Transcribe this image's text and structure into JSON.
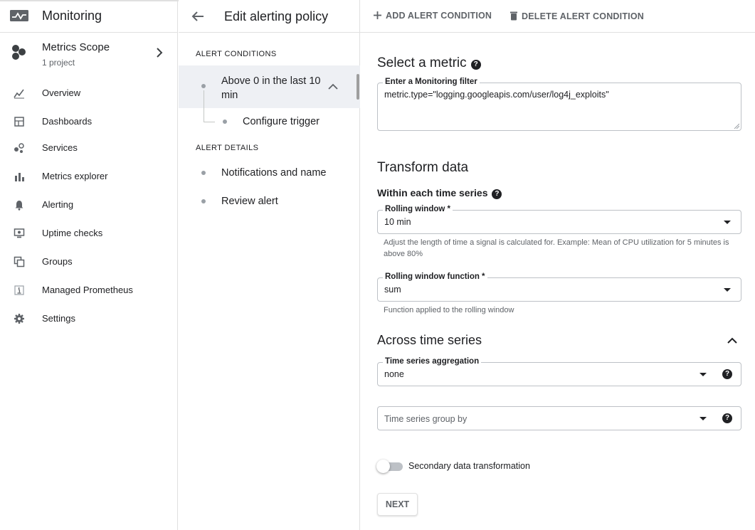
{
  "app": {
    "title": "Monitoring",
    "icon": "monitoring-logo-icon"
  },
  "scope": {
    "title": "Metrics Scope",
    "subtitle": "1 project"
  },
  "nav": [
    {
      "label": "Overview",
      "icon": "overview-icon"
    },
    {
      "label": "Dashboards",
      "icon": "dashboards-icon"
    },
    {
      "label": "Services",
      "icon": "services-icon"
    },
    {
      "label": "Metrics explorer",
      "icon": "bar-chart-icon"
    },
    {
      "label": "Alerting",
      "icon": "bell-icon"
    },
    {
      "label": "Uptime checks",
      "icon": "monitor-icon"
    },
    {
      "label": "Groups",
      "icon": "groups-icon"
    },
    {
      "label": "Managed Prometheus",
      "icon": "prometheus-icon"
    },
    {
      "label": "Settings",
      "icon": "gear-icon"
    }
  ],
  "header": {
    "title": "Edit alerting policy",
    "add_condition": "ADD ALERT CONDITION",
    "delete_condition": "DELETE ALERT CONDITION"
  },
  "steps": {
    "conditions_label": "ALERT CONDITIONS",
    "condition_1": "Above 0 in the last 10 min",
    "configure_trigger": "Configure trigger",
    "details_label": "ALERT DETAILS",
    "notifications": "Notifications and name",
    "review": "Review alert"
  },
  "metric": {
    "heading": "Select a metric",
    "filter_label": "Enter a Monitoring filter",
    "filter_value": "metric.type=\"logging.googleapis.com/user/log4j_exploits\""
  },
  "transform": {
    "heading": "Transform data",
    "within_heading": "Within each time series",
    "rolling_window_label": "Rolling window *",
    "rolling_window_value": "10 min",
    "rolling_window_hint": "Adjust the length of time a signal is calculated for. Example: Mean of CPU utilization for 5 minutes is above 80%",
    "rolling_function_label": "Rolling window function *",
    "rolling_function_value": "sum",
    "rolling_function_hint": "Function applied to the rolling window"
  },
  "across": {
    "heading": "Across time series",
    "aggregation_label": "Time series aggregation",
    "aggregation_value": "none",
    "group_by_placeholder": "Time series group by"
  },
  "secondary": {
    "label": "Secondary data transformation",
    "enabled": false
  },
  "next_label": "NEXT"
}
